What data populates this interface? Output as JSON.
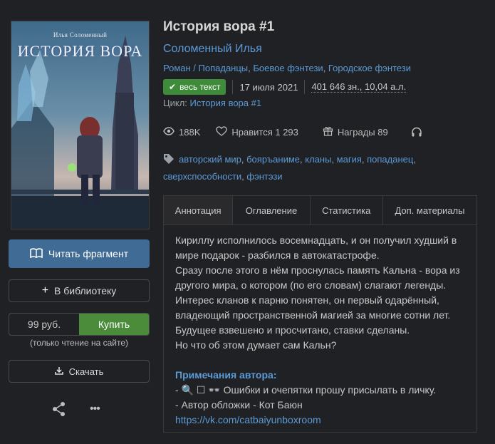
{
  "cover": {
    "author": "Илья Соломенный",
    "title": "ИСТОРИЯ ВОРА"
  },
  "actions": {
    "read_fragment": "Читать фрагмент",
    "add_library": "В библиотеку",
    "price": "99 руб.",
    "buy": "Купить",
    "price_note": "(только чтение на сайте)",
    "download": "Скачать"
  },
  "book": {
    "title": "История вора #1",
    "author": "Соломенный Илья",
    "genres": [
      "Роман / Попаданцы",
      "Боевое фэнтези",
      "Городское фэнтези"
    ],
    "status_badge": "весь текст",
    "date": "17 июля 2021",
    "size": "401 646 зн., 10,04 а.л.",
    "cycle_label": "Цикл:",
    "cycle_name": "История вора #1"
  },
  "stats": {
    "views": "188K",
    "likes": "Нравится 1 293",
    "awards": "Награды 89"
  },
  "tags": [
    "авторский мир",
    "бояръаниме",
    "кланы",
    "магия",
    "попаданец",
    "сверхспособности",
    "фэнтэзи"
  ],
  "tabs": [
    "Аннотация",
    "Оглавление",
    "Статистика",
    "Доп. материалы"
  ],
  "annotation": {
    "paragraphs": [
      "Кириллу исполнилось восемнадцать, и он получил худший в мире подарок - разбился в автокатастрофе.",
      "Сразу после этого в нём проснулась память Кальна - вора из другого мира, о котором (по его словам) слагают легенды.",
      "Интерес кланов к парню понятен, он первый одарённый, владеющий пространственной магией за многие сотни лет.",
      "Будущее взвешено и просчитано, ставки сделаны.",
      "Но что об этом думает сам Кальн?"
    ],
    "notes_title": "Примечания автора:",
    "note_line1": "- 🔍 ☐ 👓 Ошибки и очепятки прошу присылать в личку.",
    "note_line2": "- Автор обложки - Кот Баюн",
    "note_link": "https://vk.com/catbaiyunboxroom"
  },
  "colors": {
    "background": "#202124",
    "link": "#5c9ad6",
    "read_button": "#3f6b95",
    "buy_button": "#4a8c3a",
    "badge": "#3e8b3a"
  }
}
